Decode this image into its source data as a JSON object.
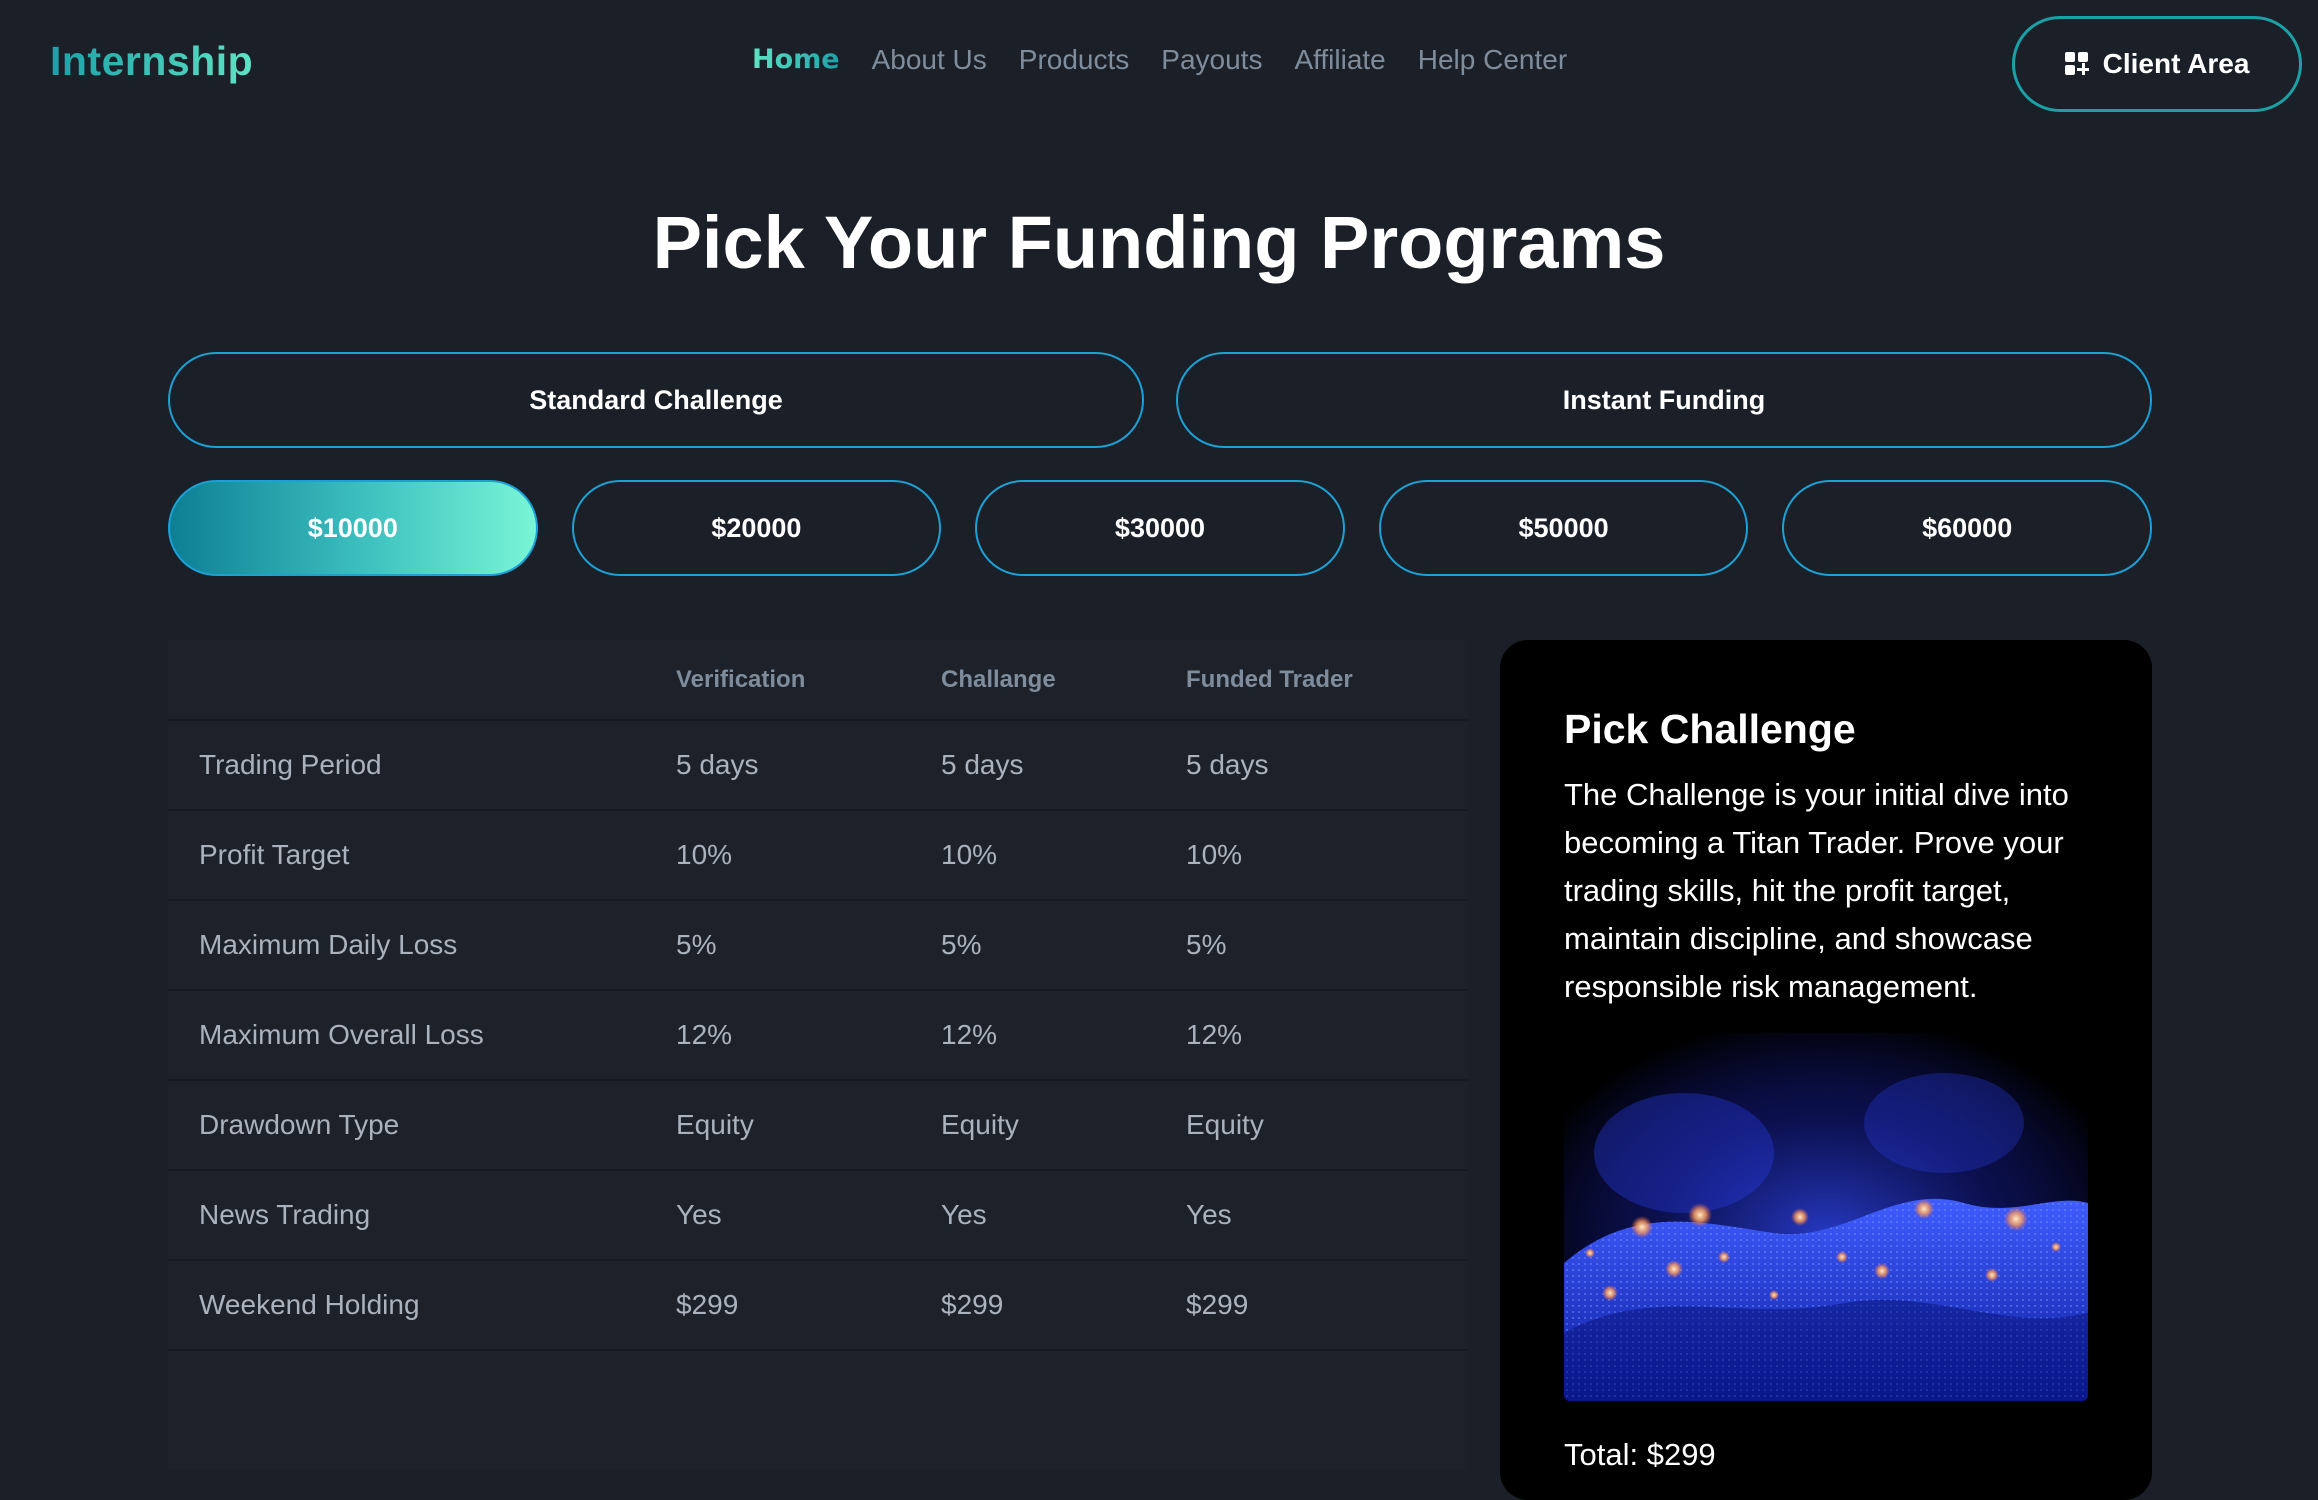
{
  "header": {
    "brand": "Internship",
    "nav": [
      {
        "label": "Home",
        "active": true
      },
      {
        "label": "About Us"
      },
      {
        "label": "Products"
      },
      {
        "label": "Payouts"
      },
      {
        "label": "Affiliate"
      },
      {
        "label": "Help Center"
      }
    ],
    "client_area_label": "Client Area",
    "client_area_icon": "grid-plus-icon"
  },
  "page_title": "Pick Your Funding Programs",
  "challenge_types": [
    {
      "label": "Standard Challenge"
    },
    {
      "label": "Instant Funding"
    }
  ],
  "amounts": [
    {
      "label": "$10000",
      "selected": true
    },
    {
      "label": "$20000"
    },
    {
      "label": "$30000"
    },
    {
      "label": "$50000"
    },
    {
      "label": "$60000"
    }
  ],
  "table": {
    "columns": [
      "",
      "Verification",
      "Challange",
      "Funded Trader"
    ],
    "rows": [
      [
        "Trading Period",
        "5 days",
        "5 days",
        "5 days"
      ],
      [
        "Profit Target",
        "10%",
        "10%",
        "10%"
      ],
      [
        "Maximum Daily Loss",
        "5%",
        "5%",
        "5%"
      ],
      [
        "Maximum Overall Loss",
        "12%",
        "12%",
        "12%"
      ],
      [
        "Drawdown Type",
        "Equity",
        "Equity",
        "Equity"
      ],
      [
        "News Trading",
        "Yes",
        "Yes",
        "Yes"
      ],
      [
        "Weekend Holding",
        "$299",
        "$299",
        "$299"
      ]
    ]
  },
  "card": {
    "title": "Pick Challenge",
    "description": "The Challenge is your initial dive into becoming a Titan Trader. Prove your trading skills, hit the profit target, maintain discipline, and showcase responsible risk management.",
    "image": "abstract-blue-wave-particles",
    "total": "Total: $299"
  },
  "colors": {
    "background": "#1b1f27",
    "accent_teal": "#1aa1a8",
    "accent_mint": "#79f5d6",
    "border_blue": "#1aa1d6",
    "muted_text": "#7f8c9b"
  }
}
